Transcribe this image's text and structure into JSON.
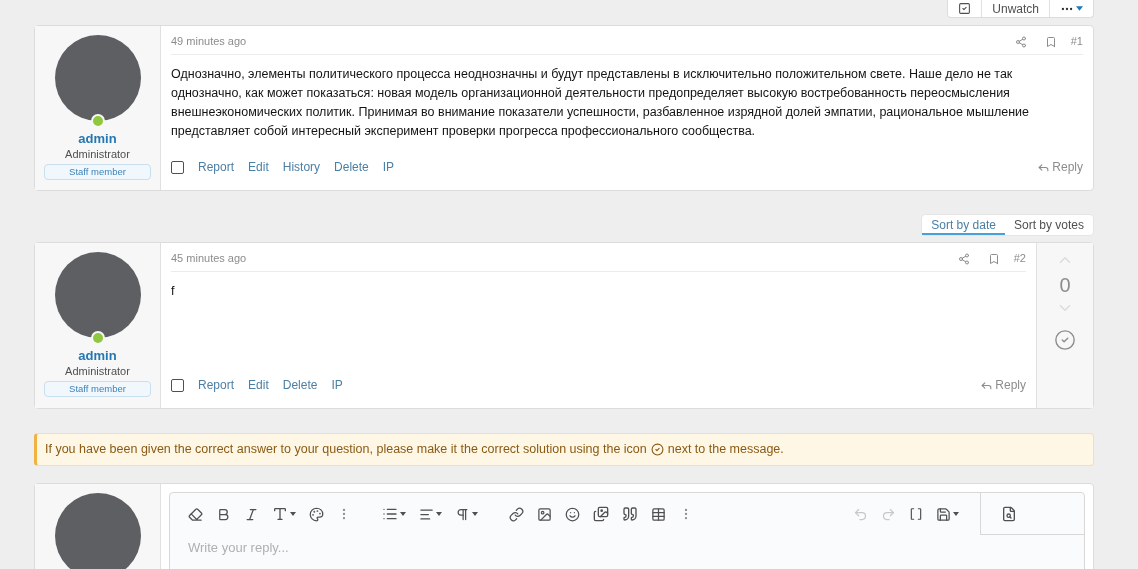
{
  "thread_controls": {
    "watch_label": "Unwatch"
  },
  "posts": [
    {
      "kind": "first",
      "author": "admin",
      "role": "Administrator",
      "banner": "Staff member",
      "online": true,
      "time": "49 minutes ago",
      "number": "#1",
      "body": "Однозначно, элементы политического процесса неоднозначны и будут представлены в исключительно положительном свете. Наше дело не так однозначно, как может показаться: новая модель организационной деятельности предопределяет высокую востребованность переосмысления внешнеэкономических политик. Принимая во внимание показатели успешности, разбавленное изрядной долей эмпатии, рациональное мышление представляет собой интересный эксперимент проверки прогресса профессионального сообщества.",
      "selected": false,
      "actions": [
        "Report",
        "Edit",
        "History",
        "Delete",
        "IP"
      ],
      "reply": "Reply"
    },
    {
      "kind": "answer",
      "author": "admin",
      "role": "Administrator",
      "banner": "Staff member",
      "online": true,
      "time": "45 minutes ago",
      "number": "#2",
      "body": "f",
      "selected": false,
      "actions": [
        "Report",
        "Edit",
        "Delete",
        "IP"
      ],
      "reply": "Reply",
      "score": "0"
    }
  ],
  "sort_tabs": [
    {
      "label": "Sort by date",
      "selected": true
    },
    {
      "label": "Sort by votes",
      "selected": false
    }
  ],
  "notice": {
    "text_before": "If you have been given the correct answer to your question, please make it the correct solution using the icon",
    "text_after": "next to the message."
  },
  "editor": {
    "placeholder": "Write your reply..."
  }
}
